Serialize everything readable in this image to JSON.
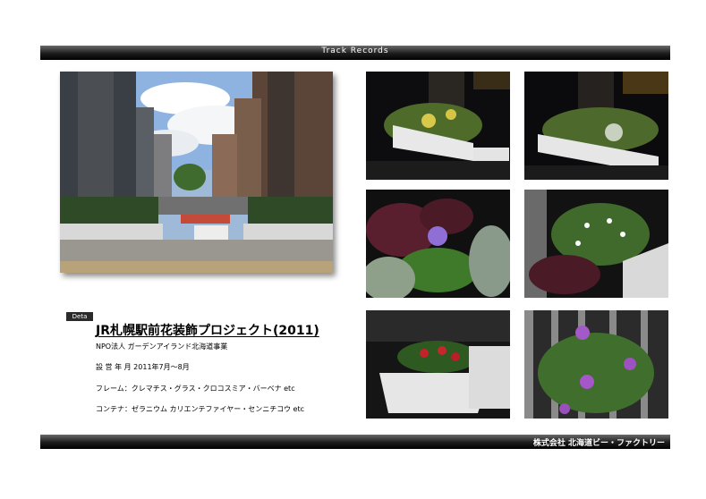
{
  "header": {
    "title": "Track Records"
  },
  "footer": {
    "company": "株式会社 北海道ビー・ファクトリー"
  },
  "details": {
    "tag": "Deta",
    "project_title": "JR札幌駅前花装飾プロジェクト(2011)",
    "organization": "NPO法人 ガーデンアイランド北海道事業",
    "period": "設 営 年 月 2011年7月～8月",
    "frame": "フレーム：クレマチス・グラス・クロコスミア・バーベナ etc",
    "container": "コンテナ：ゼラニウム カリエンテファイヤー・センニチコウ etc"
  },
  "colors": {
    "bar": "#1c1c1c",
    "bar_text": "#ffffff",
    "text": "#000000"
  }
}
